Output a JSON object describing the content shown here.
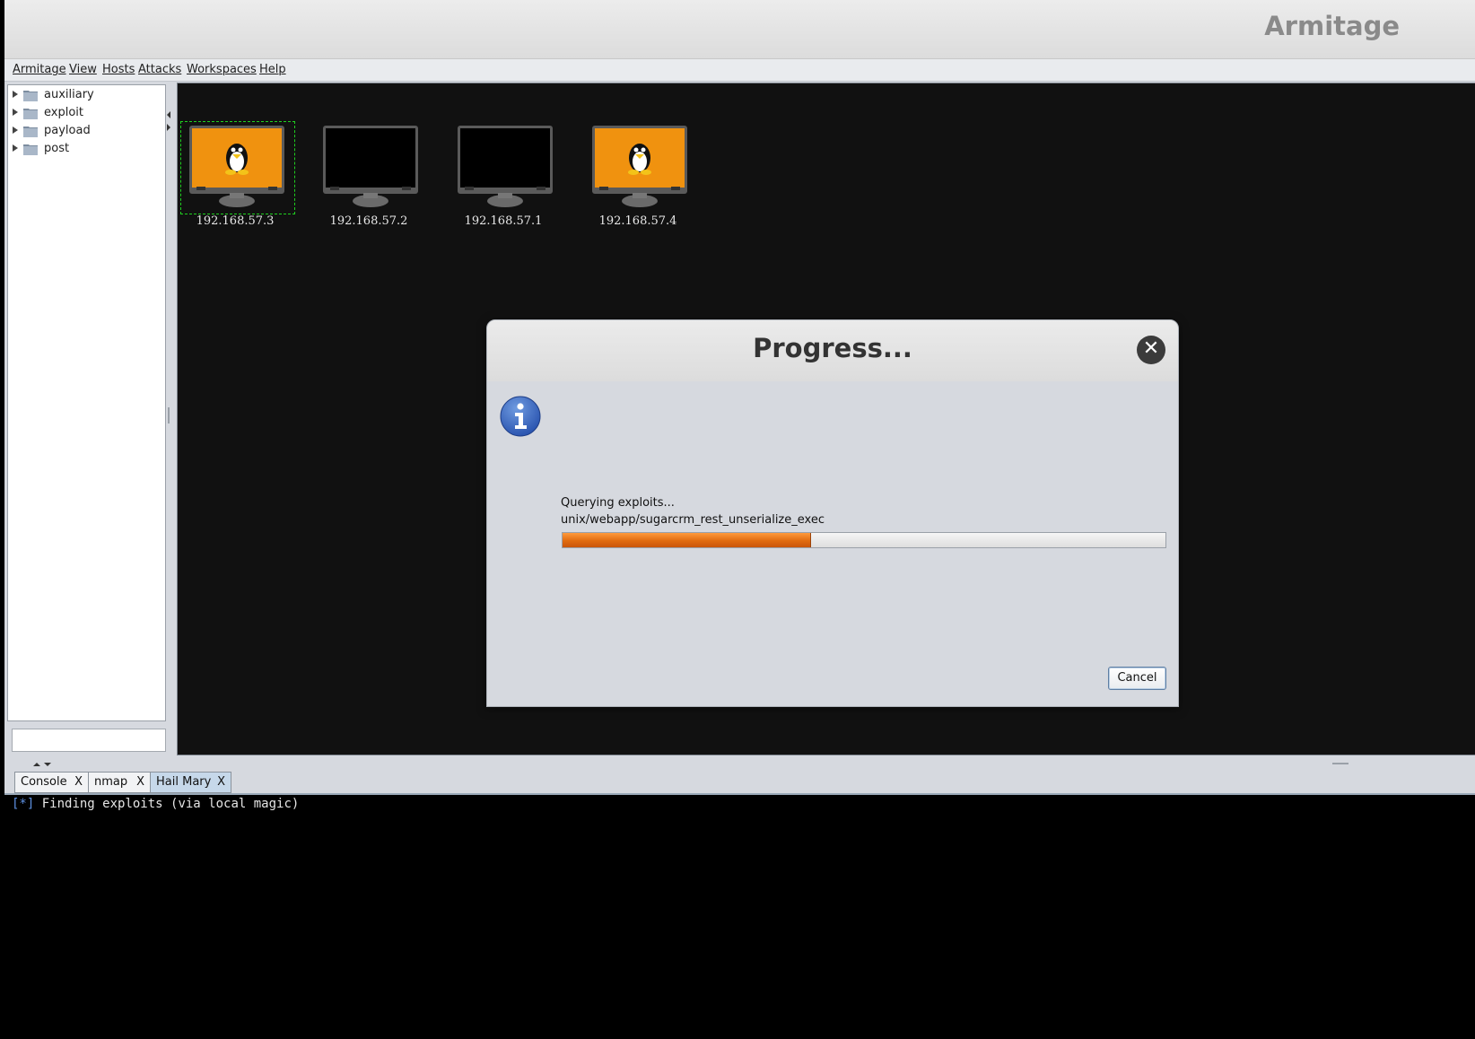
{
  "window": {
    "title": "Armitage"
  },
  "menu": [
    "Armitage",
    "View",
    "Hosts",
    "Attacks",
    "Workspaces",
    "Help"
  ],
  "module_tree": [
    {
      "label": "auxiliary",
      "icon": "folder-icon"
    },
    {
      "label": "exploit",
      "icon": "folder-icon"
    },
    {
      "label": "payload",
      "icon": "folder-icon"
    },
    {
      "label": "post",
      "icon": "folder-icon"
    }
  ],
  "search": {
    "value": ""
  },
  "hosts": [
    {
      "ip": "192.168.57.3",
      "os": "linux",
      "selected": true
    },
    {
      "ip": "192.168.57.2",
      "os": "unknown",
      "selected": false
    },
    {
      "ip": "192.168.57.1",
      "os": "unknown",
      "selected": false
    },
    {
      "ip": "192.168.57.4",
      "os": "linux",
      "selected": false
    }
  ],
  "tabs": [
    {
      "label": "Console",
      "close": "X",
      "active": false
    },
    {
      "label": "nmap",
      "close": "X",
      "active": false
    },
    {
      "label": "Hail Mary",
      "close": "X",
      "active": true
    }
  ],
  "console": {
    "prefix": "[*]",
    "text": " Finding exploits (via local magic)"
  },
  "dialog": {
    "title": "Progress...",
    "message": "Querying exploits...",
    "detail": "unix/webapp/sugarcrm_rest_unserialize_exec",
    "progress": 0.41,
    "cancel_label": "Cancel",
    "close_glyph": "✕",
    "icon": "info-icon"
  },
  "colors": {
    "accent": "#e06b10",
    "selection": "#1fd01f",
    "console_prefix": "#5d8fe0"
  }
}
